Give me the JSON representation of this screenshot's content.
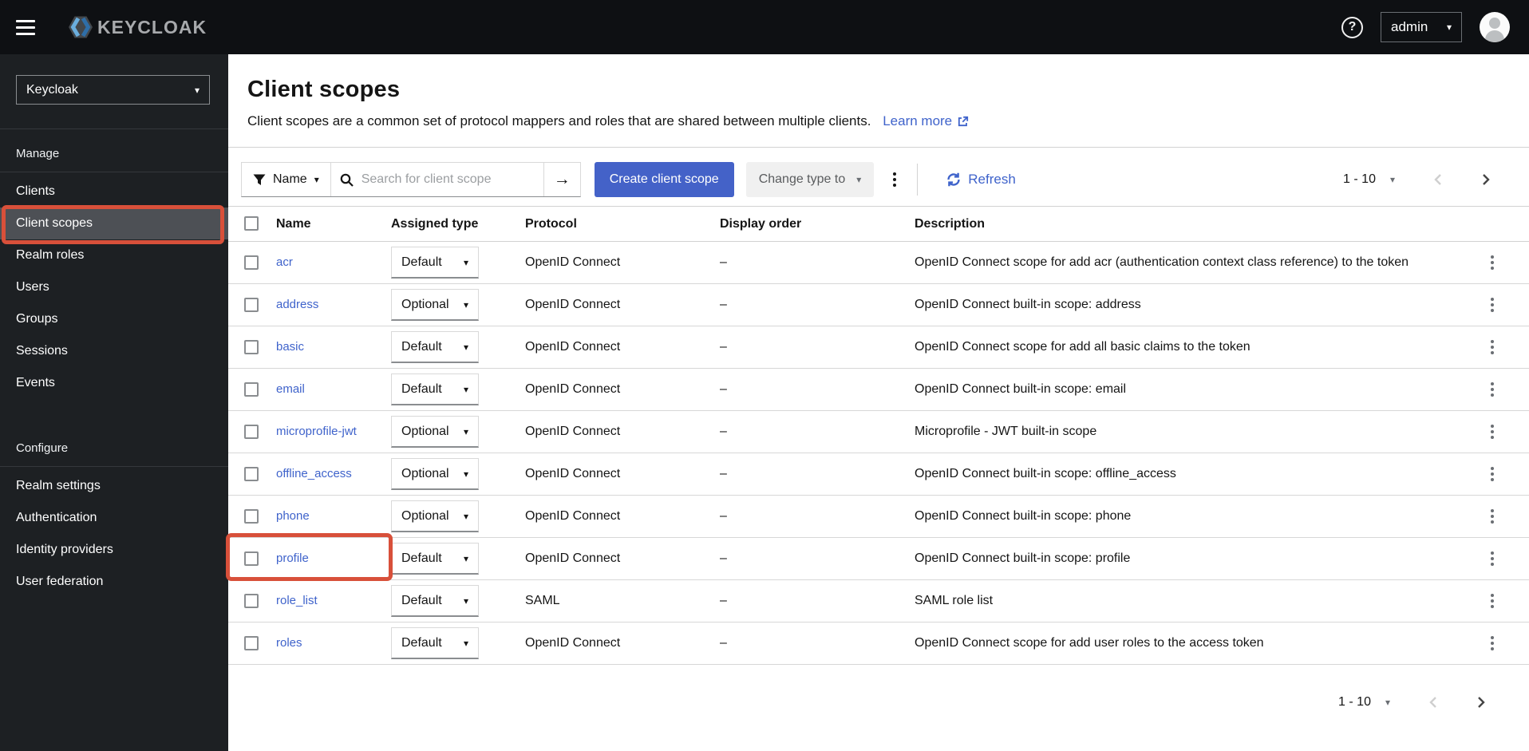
{
  "header": {
    "brand": "KEYCLOAK",
    "user_menu": {
      "label": "admin"
    }
  },
  "sidebar": {
    "realm_selector": {
      "value": "Keycloak"
    },
    "active_item": "Client scopes",
    "sections": [
      {
        "label": "Manage",
        "items": [
          "Clients",
          "Client scopes",
          "Realm roles",
          "Users",
          "Groups",
          "Sessions",
          "Events"
        ]
      },
      {
        "label": "Configure",
        "items": [
          "Realm settings",
          "Authentication",
          "Identity providers",
          "User federation"
        ]
      }
    ]
  },
  "page": {
    "title": "Client scopes",
    "description": "Client scopes are a common set of protocol mappers and roles that are shared between multiple clients.",
    "learn_more_label": "Learn more"
  },
  "toolbar": {
    "filter": {
      "label": "Name"
    },
    "search": {
      "placeholder": "Search for client scope"
    },
    "create_button_label": "Create client scope",
    "change_type_label": "Change type to",
    "refresh_label": "Refresh",
    "pagination": {
      "range": "1 - 10"
    }
  },
  "table": {
    "columns": [
      "Name",
      "Assigned type",
      "Protocol",
      "Display order",
      "Description"
    ],
    "rows": [
      {
        "name": "acr",
        "assigned_type": "Default",
        "protocol": "OpenID Connect",
        "display_order": "–",
        "description": "OpenID Connect scope for add acr (authentication context class reference) to the token",
        "highlighted": false
      },
      {
        "name": "address",
        "assigned_type": "Optional",
        "protocol": "OpenID Connect",
        "display_order": "–",
        "description": "OpenID Connect built-in scope: address",
        "highlighted": false
      },
      {
        "name": "basic",
        "assigned_type": "Default",
        "protocol": "OpenID Connect",
        "display_order": "–",
        "description": "OpenID Connect scope for add all basic claims to the token",
        "highlighted": false
      },
      {
        "name": "email",
        "assigned_type": "Default",
        "protocol": "OpenID Connect",
        "display_order": "–",
        "description": "OpenID Connect built-in scope: email",
        "highlighted": false
      },
      {
        "name": "microprofile-jwt",
        "assigned_type": "Optional",
        "protocol": "OpenID Connect",
        "display_order": "–",
        "description": "Microprofile - JWT built-in scope",
        "highlighted": false
      },
      {
        "name": "offline_access",
        "assigned_type": "Optional",
        "protocol": "OpenID Connect",
        "display_order": "–",
        "description": "OpenID Connect built-in scope: offline_access",
        "highlighted": false
      },
      {
        "name": "phone",
        "assigned_type": "Optional",
        "protocol": "OpenID Connect",
        "display_order": "–",
        "description": "OpenID Connect built-in scope: phone",
        "highlighted": false
      },
      {
        "name": "profile",
        "assigned_type": "Default",
        "protocol": "OpenID Connect",
        "display_order": "–",
        "description": "OpenID Connect built-in scope: profile",
        "highlighted": true
      },
      {
        "name": "role_list",
        "assigned_type": "Default",
        "protocol": "SAML",
        "display_order": "–",
        "description": "SAML role list",
        "highlighted": false
      },
      {
        "name": "roles",
        "assigned_type": "Default",
        "protocol": "OpenID Connect",
        "display_order": "–",
        "description": "OpenID Connect scope for add user roles to the access token",
        "highlighted": false
      }
    ]
  },
  "footer": {
    "pagination": {
      "range": "1 - 10"
    }
  },
  "colors": {
    "accent_link": "#3f63cb",
    "primary_button": "#4462c8",
    "annotation_red": "#d8503a",
    "masthead_bg": "#0e1013",
    "sidebar_bg": "#1d2023",
    "sidebar_active_bg": "#4d5055"
  },
  "icons": {
    "masthead": [
      "hamburger-icon",
      "question-circle-icon",
      "chevron-down-icon",
      "avatar"
    ],
    "toolbar": [
      "filter-funnel-icon",
      "search-icon",
      "arrow-right-icon",
      "kebab-icon",
      "refresh-icon"
    ],
    "links": [
      "external-link-icon"
    ]
  }
}
